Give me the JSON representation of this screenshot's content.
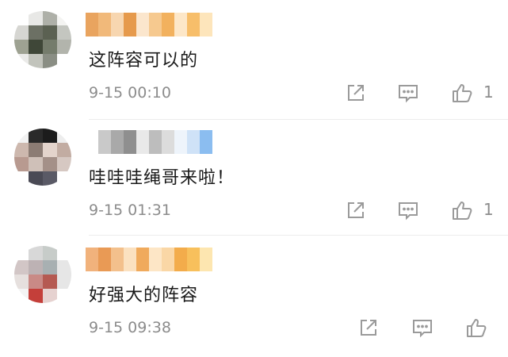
{
  "comments": [
    {
      "text": "这阵容可以的",
      "time": "9-15 00:10",
      "likes": "1",
      "avatar_colors": [
        "#ffffff",
        "#e8e8e6",
        "#aeb0a8",
        "#f4f4f2",
        "#d6d6d2",
        "#6c7064",
        "#5b6152",
        "#c4c6c0",
        "#9ea292",
        "#3f4738",
        "#757c6c",
        "#b2b4ac",
        "#eaeae8",
        "#c2c4bc",
        "#8a8e84",
        "#ffffff"
      ],
      "name_colors": [
        "#e9a45f",
        "#f1b97a",
        "#f7d6b0",
        "#e69a4c",
        "#fbe6cd",
        "#f6c98f",
        "#f2b15e",
        "#fde7c8",
        "#f7be6a",
        "#fde5bb"
      ]
    },
    {
      "text": "哇哇哇绳哥来啦！",
      "time": "9-15 01:31",
      "likes": "1",
      "avatar_colors": [
        "#f2f2f2",
        "#2a2a2a",
        "#1c1c1c",
        "#ededed",
        "#cdb8ae",
        "#8c7c74",
        "#e4d4cc",
        "#c2aca2",
        "#b89a90",
        "#cfc0b8",
        "#a49088",
        "#d6c8c2",
        "#ffffff",
        "#4a4a55",
        "#5a5a66",
        "#ffffff"
      ],
      "name_colors": [
        "#ffffff",
        "#c9c9c9",
        "#a9a9a9",
        "#8f8f8f",
        "#e9e9e9",
        "#bdbdbd",
        "#dcdcdc",
        "#eef4fb",
        "#cfe2f7",
        "#8bbdf0"
      ]
    },
    {
      "text": "好强大的阵容",
      "time": "9-15 09:38",
      "likes": "",
      "avatar_colors": [
        "#ffffff",
        "#d8d8d8",
        "#c7ccc9",
        "#ffffff",
        "#d2c6c6",
        "#bdb2b4",
        "#a8b0b2",
        "#e6e6e6",
        "#e6e0de",
        "#c98a86",
        "#b55a52",
        "#e6e6e6",
        "#f4f4f4",
        "#c43f3a",
        "#e6d2d0",
        "#ffffff"
      ],
      "name_colors": [
        "#f1b27c",
        "#e99a55",
        "#f3c08c",
        "#fbe1c0",
        "#f0aa5c",
        "#fde6c6",
        "#fad7a6",
        "#f3ac4b",
        "#f8c05c",
        "#fde6b0"
      ]
    }
  ]
}
